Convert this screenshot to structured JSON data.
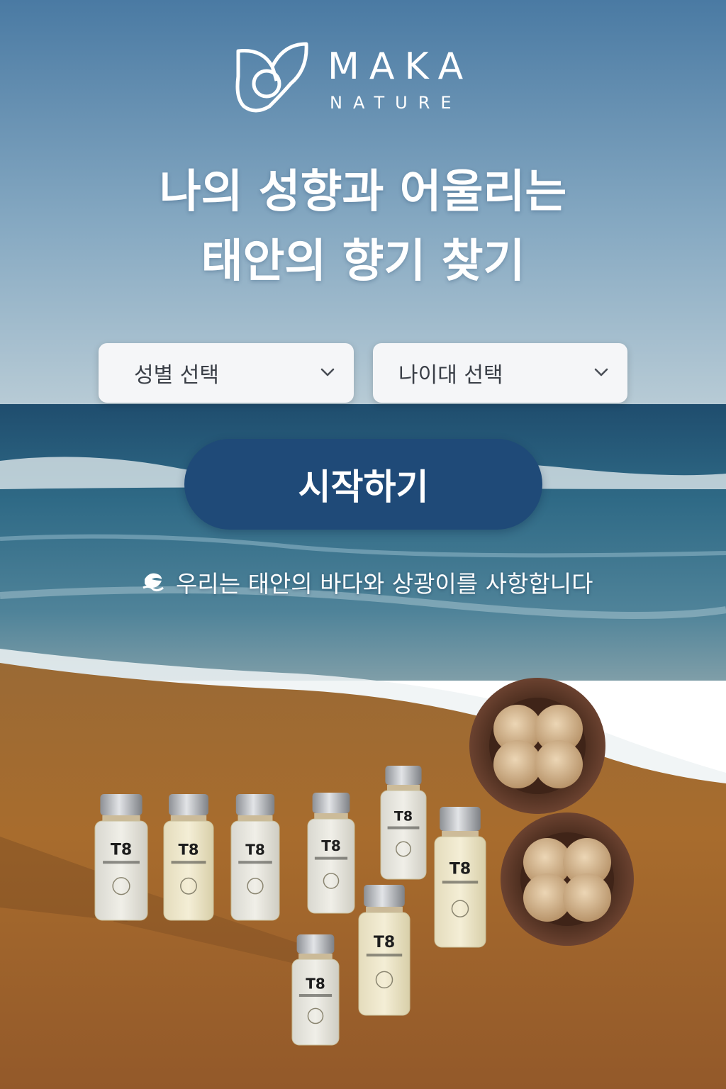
{
  "brand": {
    "name": "MAKA",
    "subtitle": "NATURE"
  },
  "headline": {
    "line1": "나의 성향과 어울리는",
    "line2": "태안의 향기 찾기"
  },
  "form": {
    "gender_select": "성별 선택",
    "age_select": "나이대 선택",
    "start_button": "시작하기"
  },
  "tagline": "우리는 태안의 바다와 상광이를 사항합니다",
  "product": {
    "label": "T8"
  },
  "colors": {
    "button": "#1f4a78",
    "sky_top": "#4a7aa3",
    "sand": "#a66a2c"
  }
}
